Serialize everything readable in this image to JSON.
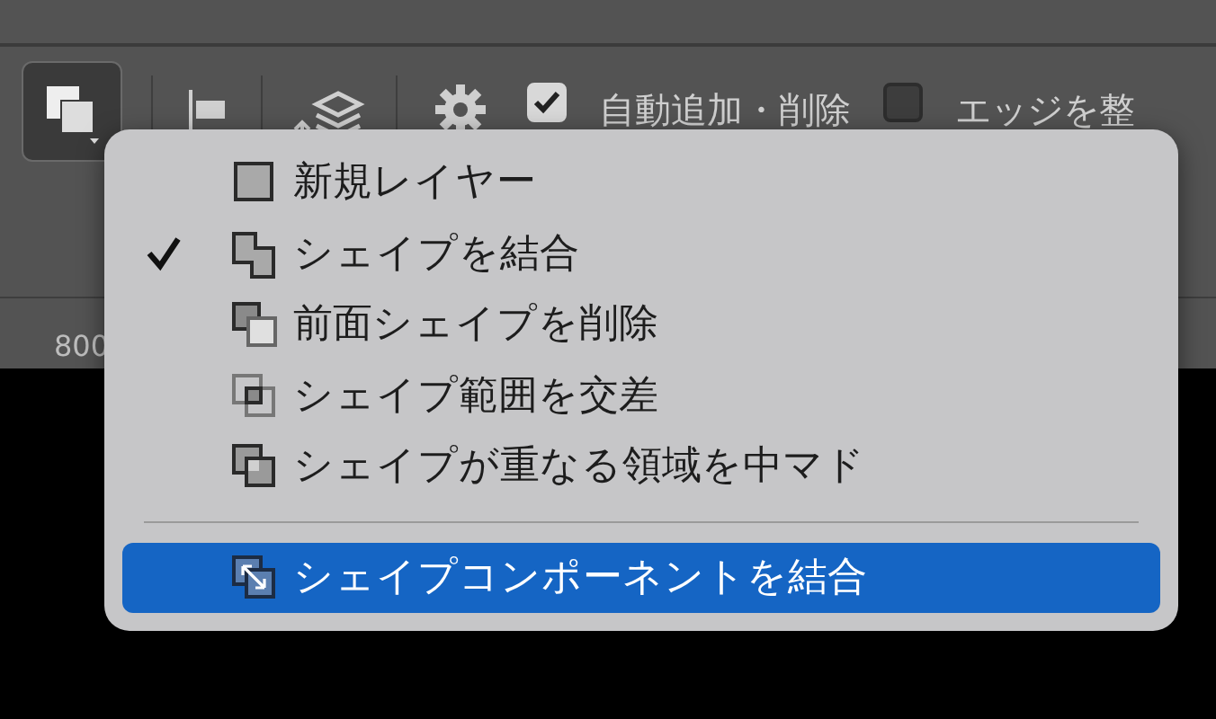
{
  "toolbar": {
    "shape_button": {
      "selected": true
    },
    "auto_add_delete": {
      "label": "自動追加・削除",
      "checked": true
    },
    "align_edges": {
      "label": "エッジを整",
      "checked": false
    }
  },
  "ruler": {
    "label": "800"
  },
  "menu": {
    "sections": [
      [
        {
          "label": "新規レイヤー",
          "kind": "new-layer",
          "checked": false,
          "selected": false
        },
        {
          "label": "シェイプを結合",
          "kind": "combine",
          "checked": true,
          "selected": false
        },
        {
          "label": "前面シェイプを削除",
          "kind": "subtract",
          "checked": false,
          "selected": false
        },
        {
          "label": "シェイプ範囲を交差",
          "kind": "intersect",
          "checked": false,
          "selected": false
        },
        {
          "label": "シェイプが重なる領域を中マド",
          "kind": "exclude",
          "checked": false,
          "selected": false
        }
      ],
      [
        {
          "label": "シェイプコンポーネントを結合",
          "kind": "merge",
          "checked": false,
          "selected": true
        }
      ]
    ]
  }
}
